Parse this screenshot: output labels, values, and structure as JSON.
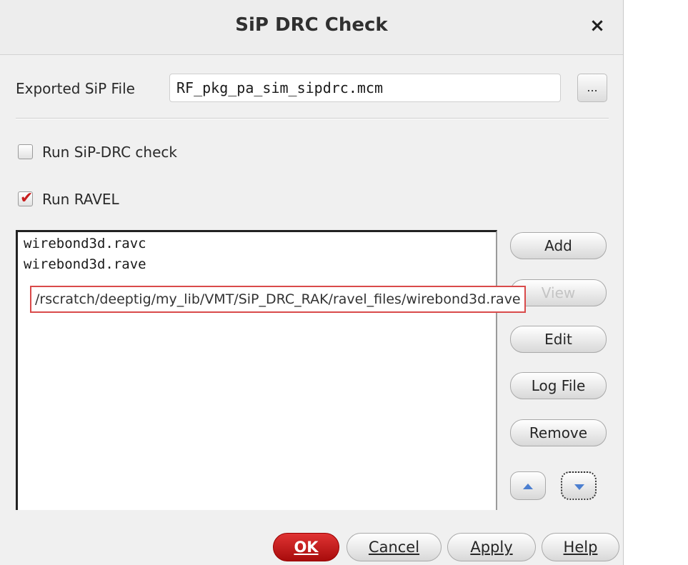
{
  "dialog": {
    "title": "SiP DRC Check",
    "close_icon": "×"
  },
  "export": {
    "label": "Exported SiP File",
    "value": "RF_pkg_pa_sim_sipdrc.mcm",
    "browse_label": "..."
  },
  "options": {
    "run_sip_drc": {
      "label": "Run SiP-DRC check",
      "checked": false
    },
    "run_ravel": {
      "label": "Run RAVEL",
      "checked": true,
      "check_mark": "✔"
    }
  },
  "file_list": {
    "items": [
      "wirebond3d.ravc",
      "wirebond3d.rave"
    ],
    "tooltip": "/rscratch/deeptig/my_lib/VMT/SiP_DRC_RAK/ravel_files/wirebond3d.rave"
  },
  "side_buttons": {
    "add": "Add",
    "view": "View",
    "edit": "Edit",
    "log_file": "Log File",
    "remove": "Remove",
    "move_up_icon": "arrow-up-icon",
    "move_down_icon": "arrow-down-icon"
  },
  "footer": {
    "ok": "OK",
    "cancel": "Cancel",
    "apply": "Apply",
    "help": "Help"
  },
  "colors": {
    "ok_button": "#c81e1e",
    "check_mark": "#c81e1e",
    "tooltip_border": "#d94a4a",
    "arrow": "#4c7fd0"
  }
}
